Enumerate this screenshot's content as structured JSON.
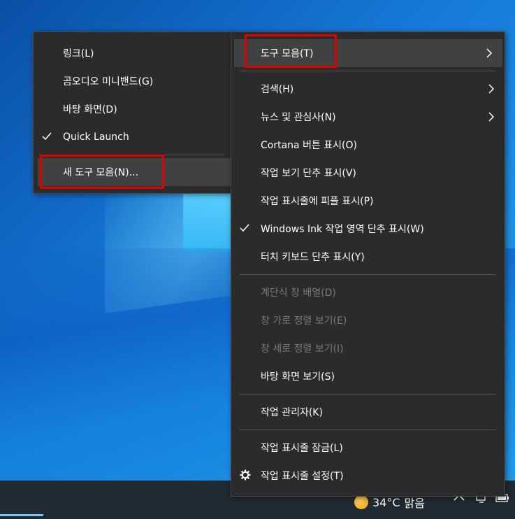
{
  "left_menu": {
    "items": [
      {
        "label": "링크(L)",
        "checked": false
      },
      {
        "label": "곰오디오 미니밴드(G)",
        "checked": false
      },
      {
        "label": "바탕 화면(D)",
        "checked": false
      },
      {
        "label": "Quick Launch",
        "checked": true
      },
      {
        "label": "새 도구 모음(N)...",
        "checked": false,
        "highlighted": true
      }
    ]
  },
  "right_menu": {
    "items": [
      {
        "label": "도구 모음(T)",
        "submenu": true,
        "highlighted": true
      },
      {
        "label": "검색(H)",
        "submenu": true
      },
      {
        "label": "뉴스 및 관심사(N)",
        "submenu": true
      },
      {
        "label": "Cortana 버튼 표시(O)"
      },
      {
        "label": "작업 보기 단추 표시(V)"
      },
      {
        "label": "작업 표시줄에 피플 표시(P)"
      },
      {
        "label": "Windows Ink 작업 영역 단추 표시(W)",
        "checked": true
      },
      {
        "label": "터치 키보드 단추 표시(Y)"
      },
      {
        "label": "계단식 창 배열(D)",
        "disabled": true
      },
      {
        "label": "창 가로 정렬 보기(E)",
        "disabled": true
      },
      {
        "label": "창 세로 정렬 보기(I)",
        "disabled": true
      },
      {
        "label": "바탕 화면 보기(S)"
      },
      {
        "label": "작업 관리자(K)"
      },
      {
        "label": "작업 표시줄 잠금(L)"
      },
      {
        "label": "작업 표시줄 설정(T)",
        "icon": "gear-icon"
      }
    ]
  },
  "taskbar": {
    "weather_temp": "34°C",
    "weather_text": "맑음",
    "weather_icon": "sun-icon"
  },
  "colors": {
    "menu_bg": "#2b2b2b",
    "hover_bg": "#414141",
    "highlight_border": "#e00000",
    "disabled_text": "#7a7a7a"
  }
}
